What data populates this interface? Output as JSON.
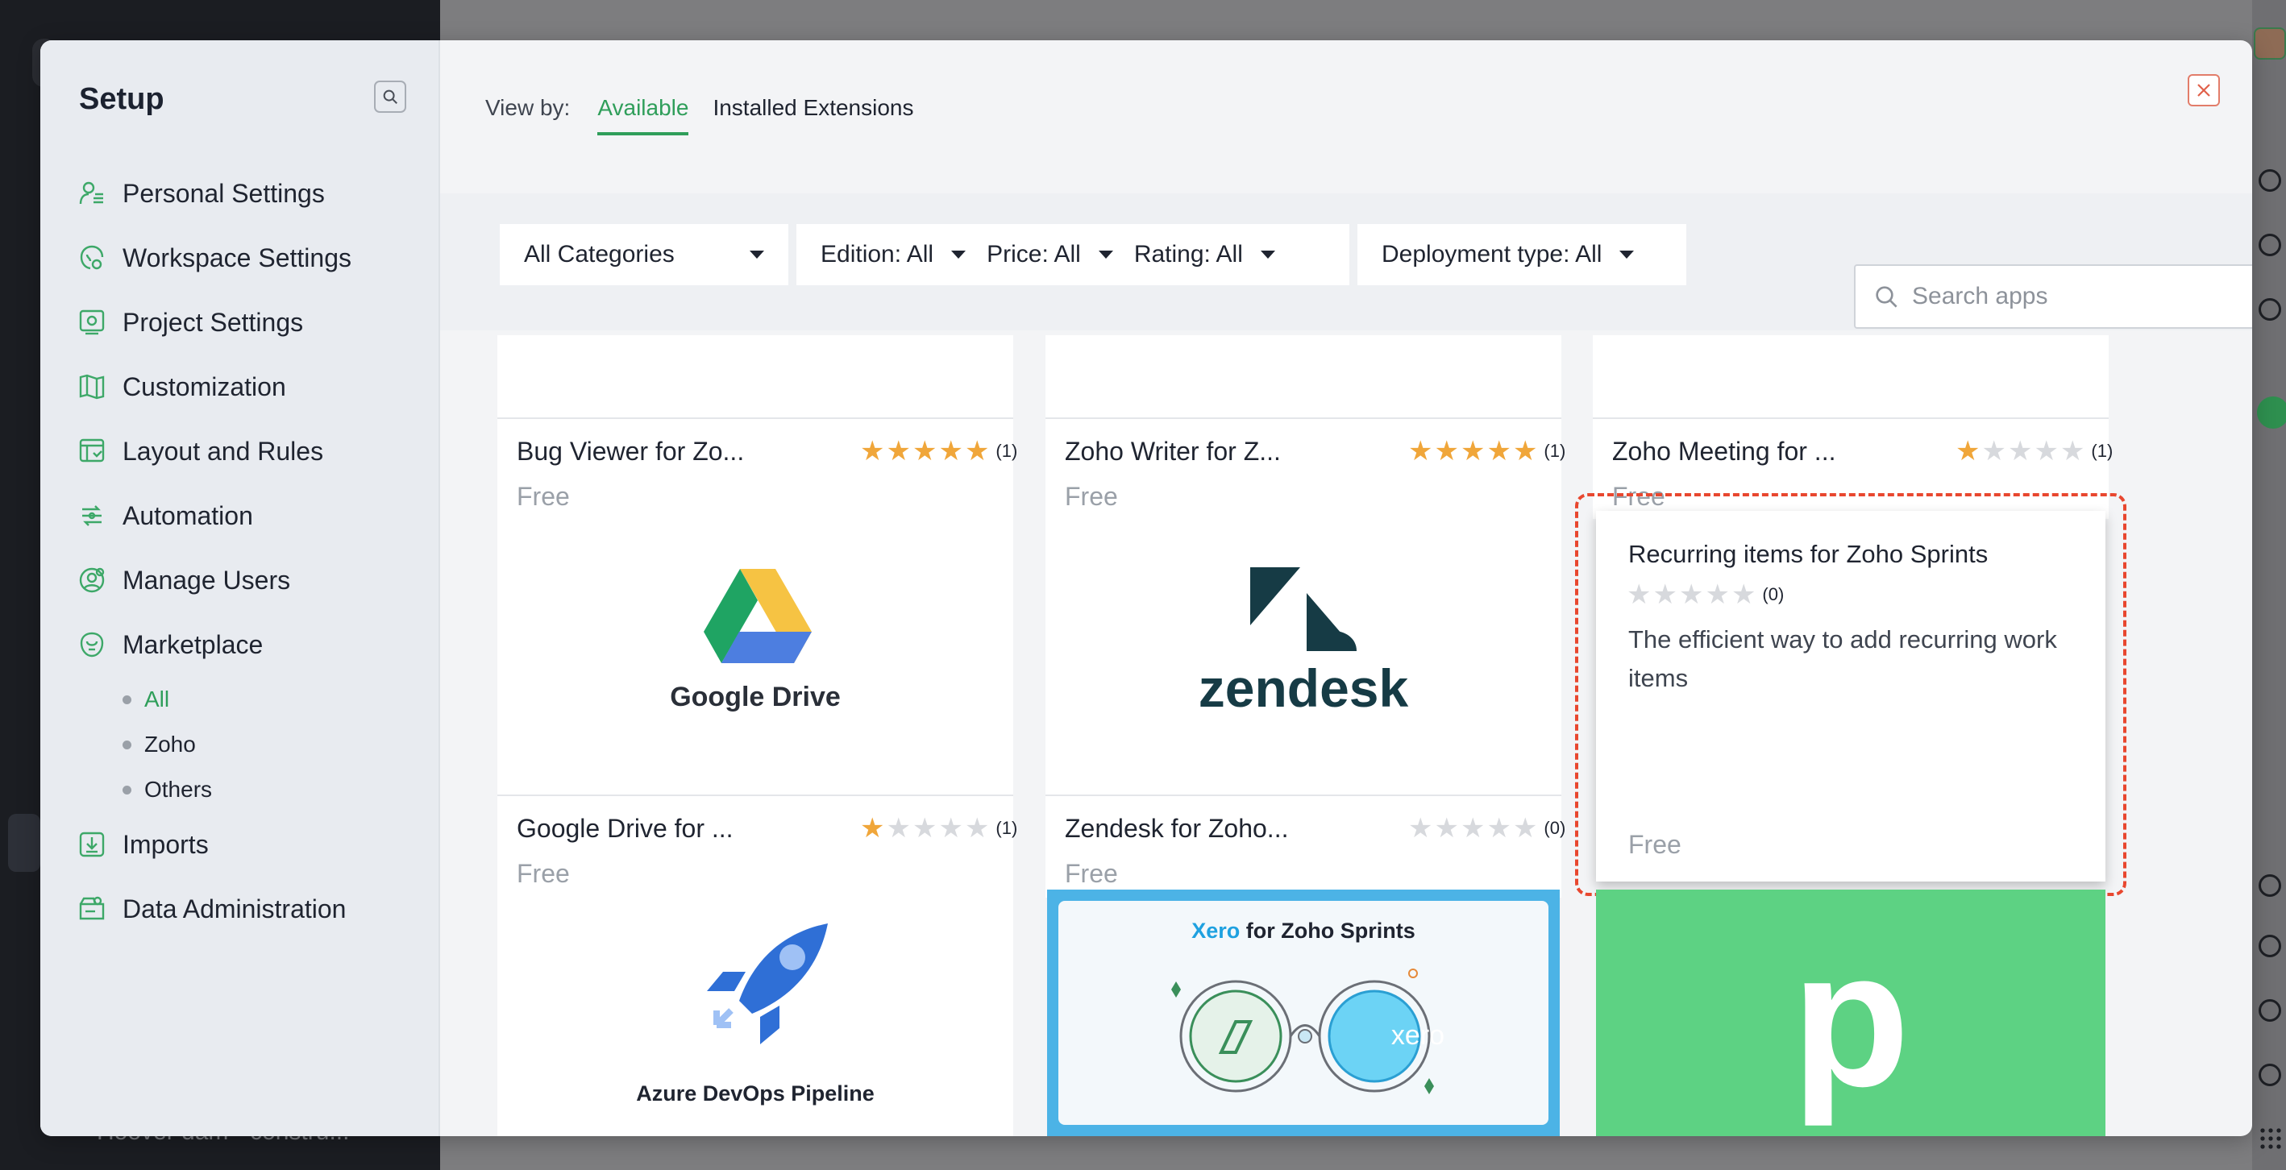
{
  "background": {
    "truncated_item": "Hoover dam - constru..."
  },
  "sidebar": {
    "title": "Setup",
    "items": [
      {
        "label": "Personal Settings",
        "icon": "personal-settings-icon"
      },
      {
        "label": "Workspace Settings",
        "icon": "workspace-settings-icon"
      },
      {
        "label": "Project Settings",
        "icon": "project-settings-icon"
      },
      {
        "label": "Customization",
        "icon": "customization-icon"
      },
      {
        "label": "Layout and Rules",
        "icon": "layout-rules-icon"
      },
      {
        "label": "Automation",
        "icon": "automation-icon"
      },
      {
        "label": "Manage Users",
        "icon": "manage-users-icon"
      },
      {
        "label": "Marketplace",
        "icon": "marketplace-icon"
      },
      {
        "label": "Imports",
        "icon": "imports-icon"
      },
      {
        "label": "Data Administration",
        "icon": "data-administration-icon"
      }
    ],
    "marketplace_sub": [
      {
        "label": "All",
        "active": true
      },
      {
        "label": "Zoho",
        "active": false
      },
      {
        "label": "Others",
        "active": false
      }
    ]
  },
  "header": {
    "view_by_label": "View by:",
    "tabs": [
      {
        "label": "Available",
        "active": true
      },
      {
        "label": "Installed Extensions",
        "active": false
      }
    ]
  },
  "filters": {
    "categories": "All Categories",
    "edition": "Edition: All",
    "price": "Price: All",
    "rating": "Rating: All",
    "deployment": "Deployment type: All",
    "search_placeholder": "Search apps"
  },
  "cards_row1": [
    {
      "name": "Bug Viewer for Zo...",
      "rating": 5,
      "count": "(1)",
      "price": "Free"
    },
    {
      "name": "Zoho Writer for Z...",
      "rating": 5,
      "count": "(1)",
      "price": "Free"
    },
    {
      "name": "Zoho Meeting for ...",
      "rating": 1,
      "count": "(1)",
      "price": "Free"
    }
  ],
  "cards_row2": [
    {
      "name": "Google Drive for ...",
      "rating": 1,
      "count": "(1)",
      "price": "Free",
      "logo_text": "Google Drive"
    },
    {
      "name": "Zendesk for Zoho...",
      "rating": 0,
      "count": "(0)",
      "price": "Free",
      "logo_text": "zendesk"
    }
  ],
  "highlight_card": {
    "name": "Recurring items for Zoho Sprints",
    "rating": 0,
    "count": "(0)",
    "description": "The efficient way to add recurring work items",
    "price": "Free"
  },
  "cards_row3": [
    {
      "logo_text": "Azure DevOps Pipeline"
    },
    {
      "title_part1": "Xero",
      "title_part2": " for Zoho Sprints",
      "logo_word": "xero"
    },
    {
      "logo_letter": "p"
    }
  ],
  "colors": {
    "accent_green": "#2f9e5a",
    "star": "#f0a63a",
    "highlight_border": "#e8472f"
  }
}
